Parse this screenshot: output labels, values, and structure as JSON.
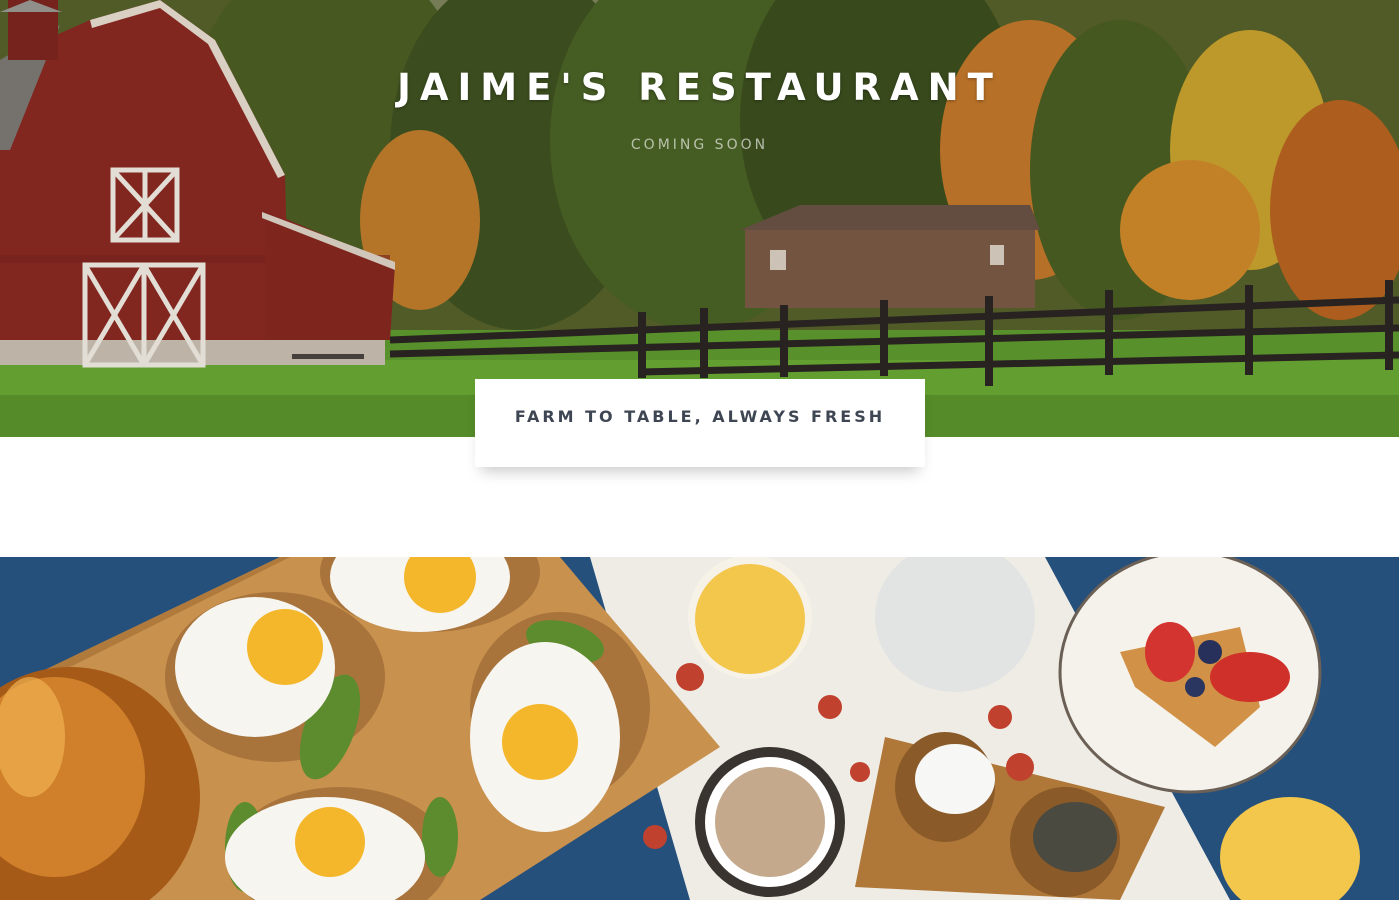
{
  "hero": {
    "title": "JAIME'S RESTAURANT",
    "tagline": "COMING SOON",
    "promo": "FARM TO TABLE, ALWAYS FRESH"
  },
  "colors": {
    "title_text": "#ffffff",
    "promo_text": "#3f4653",
    "barn_red": "#8a2a22",
    "tablecloth_blue": "#24507e"
  },
  "images": {
    "hero_background": "photo-barn-fence-autumn-trees",
    "food_background": "photo-breakfast-eggs-avocado-toast"
  }
}
